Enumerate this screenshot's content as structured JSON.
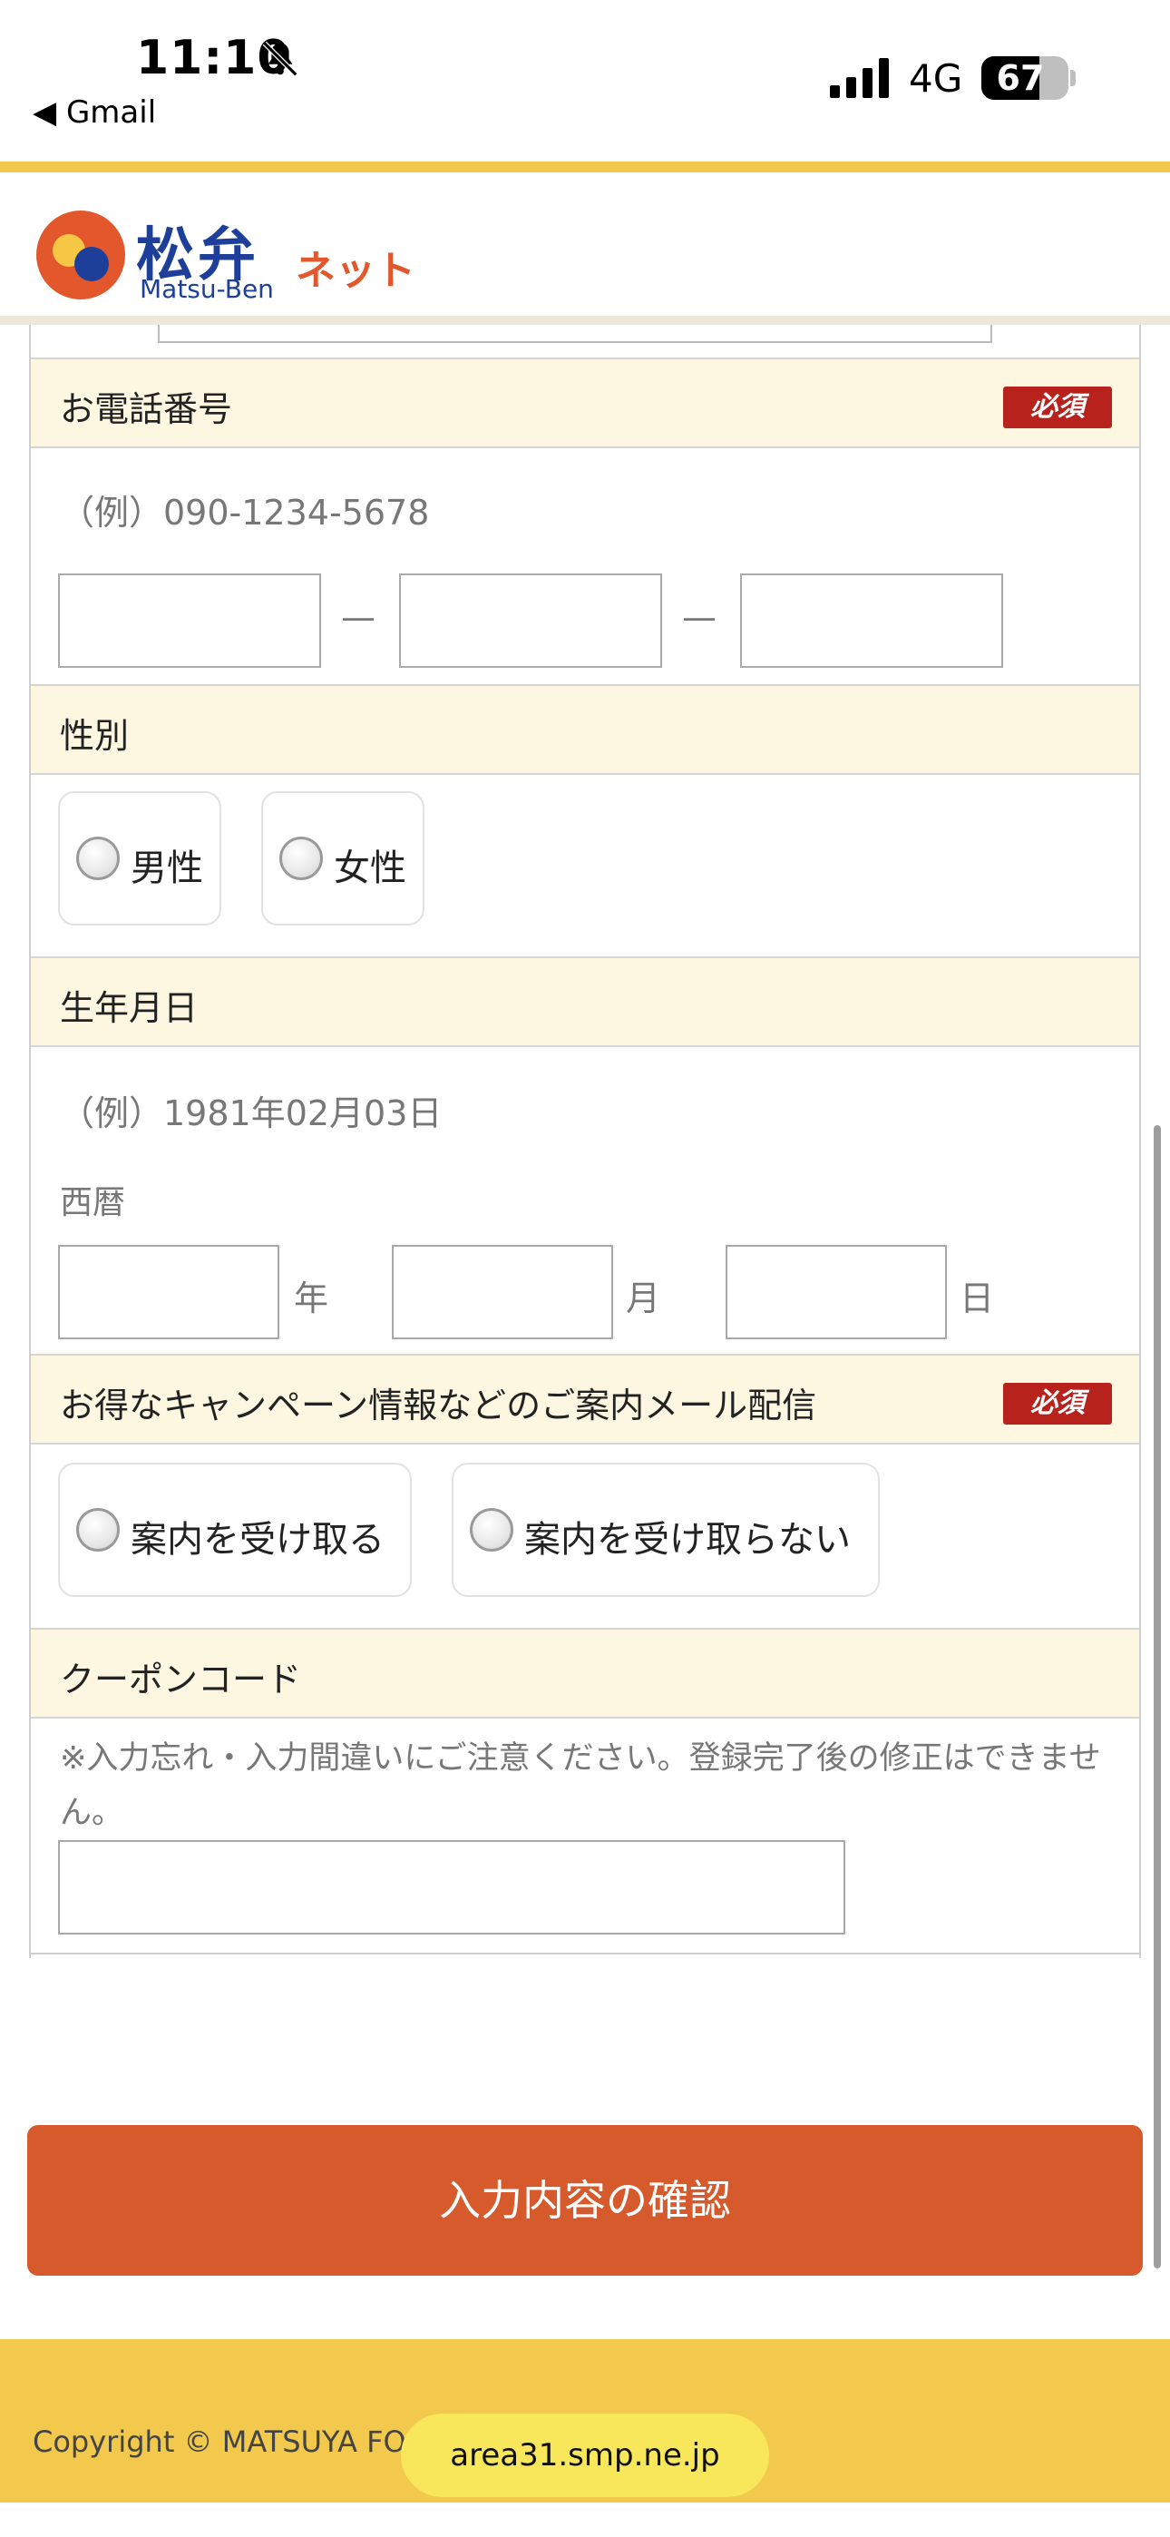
{
  "status_bar": {
    "time": "11:10",
    "back_label": "◀ Gmail",
    "network": "4G",
    "battery": "67",
    "battery_level": 0.67
  },
  "header": {
    "logo_kanji": "松弁",
    "logo_roman": "Matsu-Ben",
    "logo_suffix": "ネット"
  },
  "form": {
    "required_badge": "必須",
    "phone": {
      "label": "お電話番号",
      "example": "（例）090-1234-5678",
      "separator": "—"
    },
    "gender": {
      "label": "性別",
      "options": [
        "男性",
        "女性"
      ]
    },
    "birthday": {
      "label": "生年月日",
      "example": "（例）1981年02月03日",
      "era": "西暦",
      "year_unit": "年",
      "month_unit": "月",
      "day_unit": "日"
    },
    "newsletter": {
      "label": "お得なキャンペーン情報などのご案内メール配信",
      "options": [
        "案内を受け取る",
        "案内を受け取らない"
      ]
    },
    "coupon": {
      "label": "クーポンコード",
      "note": "※入力忘れ・入力間違いにご注意ください。登録完了後の修正はできません。"
    }
  },
  "submit_label": "入力内容の確認",
  "footer": {
    "copyright": "Copyright © MATSUYA FOO                    All Rights Reserved."
  },
  "url_pill": "area31.smp.ne.jp",
  "colors": {
    "accent_yellow": "#f2c94c",
    "submit_orange": "#d75a2c",
    "required_red": "#b7221c",
    "brand_blue": "#1d3f9a",
    "row_header_bg": "#fdf6e0"
  }
}
